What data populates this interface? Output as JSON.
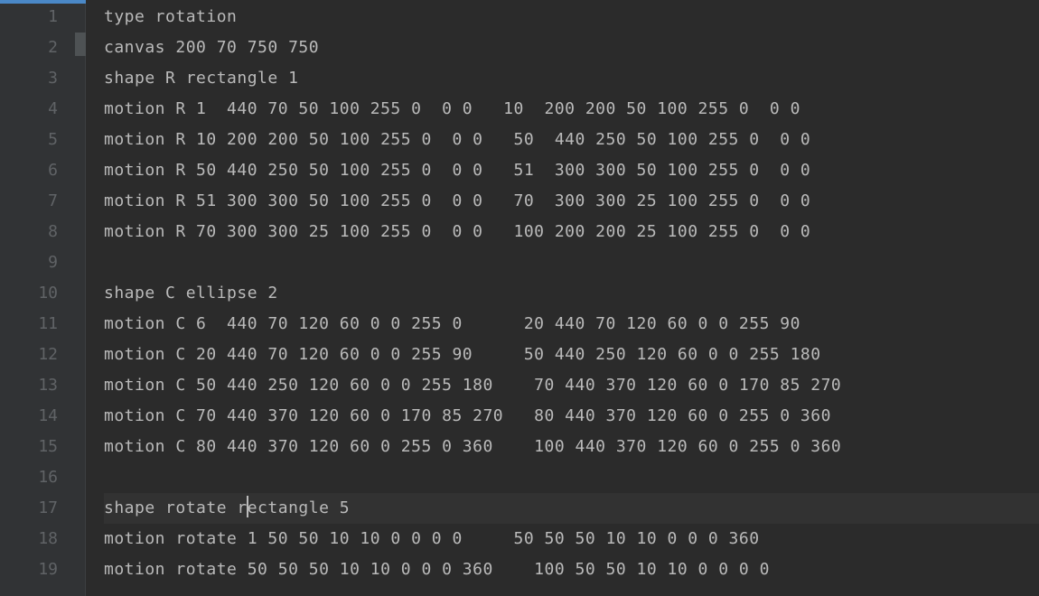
{
  "editor": {
    "lines": [
      {
        "num": "1",
        "text": "type rotation",
        "current": false
      },
      {
        "num": "2",
        "text": "canvas 200 70 750 750",
        "current": false
      },
      {
        "num": "3",
        "text": "shape R rectangle 1",
        "current": false
      },
      {
        "num": "4",
        "text": "motion R 1  440 70 50 100 255 0  0 0   10  200 200 50 100 255 0  0 0",
        "current": false
      },
      {
        "num": "5",
        "text": "motion R 10 200 200 50 100 255 0  0 0   50  440 250 50 100 255 0  0 0",
        "current": false
      },
      {
        "num": "6",
        "text": "motion R 50 440 250 50 100 255 0  0 0   51  300 300 50 100 255 0  0 0",
        "current": false
      },
      {
        "num": "7",
        "text": "motion R 51 300 300 50 100 255 0  0 0   70  300 300 25 100 255 0  0 0",
        "current": false
      },
      {
        "num": "8",
        "text": "motion R 70 300 300 25 100 255 0  0 0   100 200 200 25 100 255 0  0 0",
        "current": false
      },
      {
        "num": "9",
        "text": "",
        "current": false
      },
      {
        "num": "10",
        "text": "shape C ellipse 2",
        "current": false
      },
      {
        "num": "11",
        "text": "motion C 6  440 70 120 60 0 0 255 0      20 440 70 120 60 0 0 255 90",
        "current": false
      },
      {
        "num": "12",
        "text": "motion C 20 440 70 120 60 0 0 255 90     50 440 250 120 60 0 0 255 180",
        "current": false
      },
      {
        "num": "13",
        "text": "motion C 50 440 250 120 60 0 0 255 180    70 440 370 120 60 0 170 85 270",
        "current": false
      },
      {
        "num": "14",
        "text": "motion C 70 440 370 120 60 0 170 85 270   80 440 370 120 60 0 255 0 360",
        "current": false
      },
      {
        "num": "15",
        "text": "motion C 80 440 370 120 60 0 255 0 360    100 440 370 120 60 0 255 0 360",
        "current": false
      },
      {
        "num": "16",
        "text": "",
        "current": false
      },
      {
        "num": "17",
        "text": "shape rotate rectangle 5",
        "current": true,
        "cursorAfter": 14
      },
      {
        "num": "18",
        "text": "motion rotate 1 50 50 10 10 0 0 0 0     50 50 50 10 10 0 0 0 360",
        "current": false
      },
      {
        "num": "19",
        "text": "motion rotate 50 50 50 10 10 0 0 0 360    100 50 50 10 10 0 0 0 0",
        "current": false
      }
    ]
  }
}
